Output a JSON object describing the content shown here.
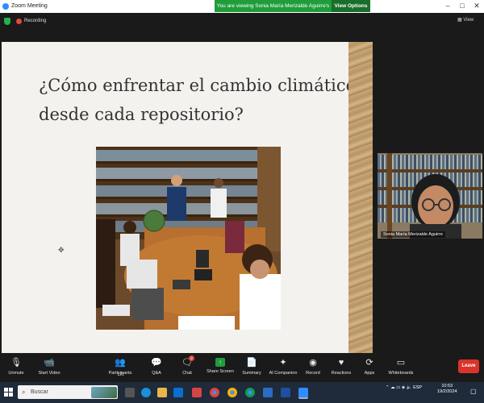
{
  "window": {
    "title": "Zoom Meeting",
    "viewing_banner": "You are viewing Sonia María Merizalde Aguirre's screen",
    "view_options": "View Options",
    "minimize": "–",
    "maximize": "□",
    "close": "✕"
  },
  "status": {
    "recording": "Recording",
    "view": "View"
  },
  "slide": {
    "title_line1": "¿Cómo enfrentar el cambio climático",
    "title_line2": "desde cada repositorio?"
  },
  "participant": {
    "name": "Sonia María Merizalde Aguirre"
  },
  "toolbar": {
    "unmute": "Unmute",
    "start_video": "Start Video",
    "participants": "Participants",
    "participants_count": "121",
    "qa": "Q&A",
    "chat": "Chat",
    "chat_badge": "2",
    "share_screen": "Share Screen",
    "summary": "Summary",
    "ai_companion": "AI Companion",
    "record": "Record",
    "reactions": "Reactions",
    "apps": "Apps",
    "whiteboards": "Whiteboards",
    "leave": "Leave"
  },
  "taskbar": {
    "search_placeholder": "Buscar",
    "language": "ESP",
    "time": "10:53",
    "date": "19/2/2024"
  },
  "colors": {
    "accent_green": "#1f9d3a",
    "leave_red": "#d9342b",
    "zoom_blue": "#2d8cff"
  }
}
